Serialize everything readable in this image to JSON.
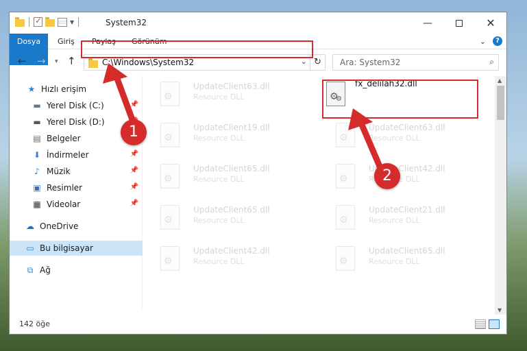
{
  "window": {
    "title": "System32",
    "minimize_label": "—",
    "close_label": "✕"
  },
  "ribbon": {
    "tabs": [
      "Dosya",
      "Giriş",
      "Paylaş",
      "Görünüm"
    ],
    "expand_label": "⌄",
    "help_label": "?"
  },
  "navbar": {
    "address": "C:\\Windows\\System32",
    "search_placeholder": "Ara: System32"
  },
  "sidebar": {
    "items": [
      {
        "label": "Hızlı erişim",
        "icon": "star-icon",
        "pinned": false
      },
      {
        "label": "Yerel Disk (C:)",
        "icon": "drive-icon",
        "pinned": true
      },
      {
        "label": "Yerel Disk (D:)",
        "icon": "drive-icon",
        "pinned": true
      },
      {
        "label": "Belgeler",
        "icon": "document-icon",
        "pinned": true
      },
      {
        "label": "İndirmeler",
        "icon": "download-icon",
        "pinned": true
      },
      {
        "label": "Müzik",
        "icon": "music-icon",
        "pinned": true
      },
      {
        "label": "Resimler",
        "icon": "picture-icon",
        "pinned": true
      },
      {
        "label": "Videolar",
        "icon": "video-icon",
        "pinned": true
      },
      {
        "label": "OneDrive",
        "icon": "cloud-icon",
        "pinned": false
      },
      {
        "label": "Bu bilgisayar",
        "icon": "computer-icon",
        "pinned": false,
        "selected": true
      },
      {
        "label": "Ağ",
        "icon": "network-icon",
        "pinned": false
      }
    ]
  },
  "files": [
    {
      "name": "UpdateClient63.dll",
      "type": "Resource DLL"
    },
    {
      "name": "fx_delilah32.dll",
      "type": "",
      "featured": true
    },
    {
      "name": "UpdateClient19.dll",
      "type": "Resource DLL"
    },
    {
      "name": "UpdateClient63.dll",
      "type": "Resource DLL"
    },
    {
      "name": "UpdateClient65.dll",
      "type": "Resource DLL"
    },
    {
      "name": "UpdateClient42.dll",
      "type": "Resource DLL"
    },
    {
      "name": "UpdateClient65.dll",
      "type": "Resource DLL"
    },
    {
      "name": "UpdateClient21.dll",
      "type": "Resource DLL"
    },
    {
      "name": "UpdateClient42.dll",
      "type": "Resource DLL"
    },
    {
      "name": "UpdateClient65.dll",
      "type": "Resource DLL"
    }
  ],
  "status": {
    "item_count": "142 öğe"
  },
  "annotations": {
    "step1": "1",
    "step2": "2",
    "color": "#d62b2b"
  }
}
